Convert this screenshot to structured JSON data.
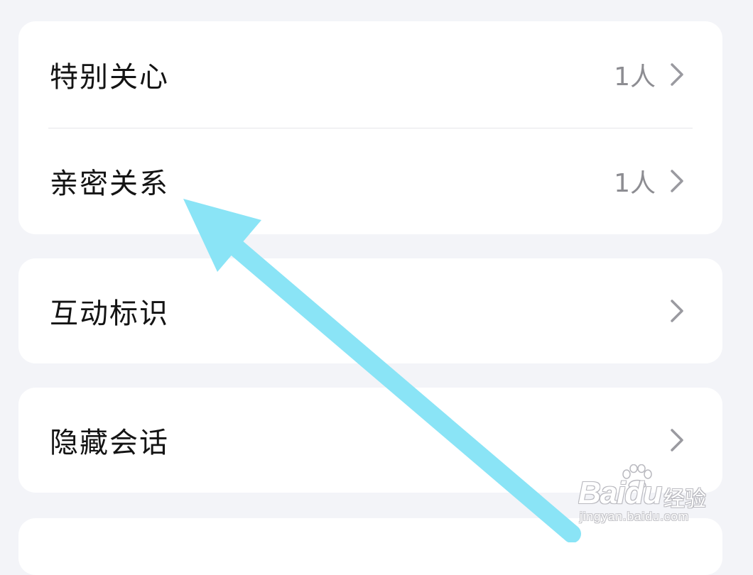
{
  "settings": {
    "groups": [
      {
        "items": [
          {
            "label": "特别关心",
            "count": "1人"
          },
          {
            "label": "亲密关系",
            "count": "1人"
          }
        ]
      },
      {
        "items": [
          {
            "label": "互动标识"
          }
        ]
      },
      {
        "items": [
          {
            "label": "隐藏会话"
          }
        ]
      }
    ]
  },
  "watermark": {
    "logo": "Baidu",
    "brand": "经验",
    "url": "jingyan.baidu.com"
  },
  "colors": {
    "background": "#f3f4f8",
    "card": "#ffffff",
    "label_text": "#141414",
    "secondary_text": "#8d8d92",
    "arrow": "#8ae4f6"
  },
  "icons": {
    "row_chevron": "chevron-right-icon",
    "annotation": "annotation-arrow"
  }
}
